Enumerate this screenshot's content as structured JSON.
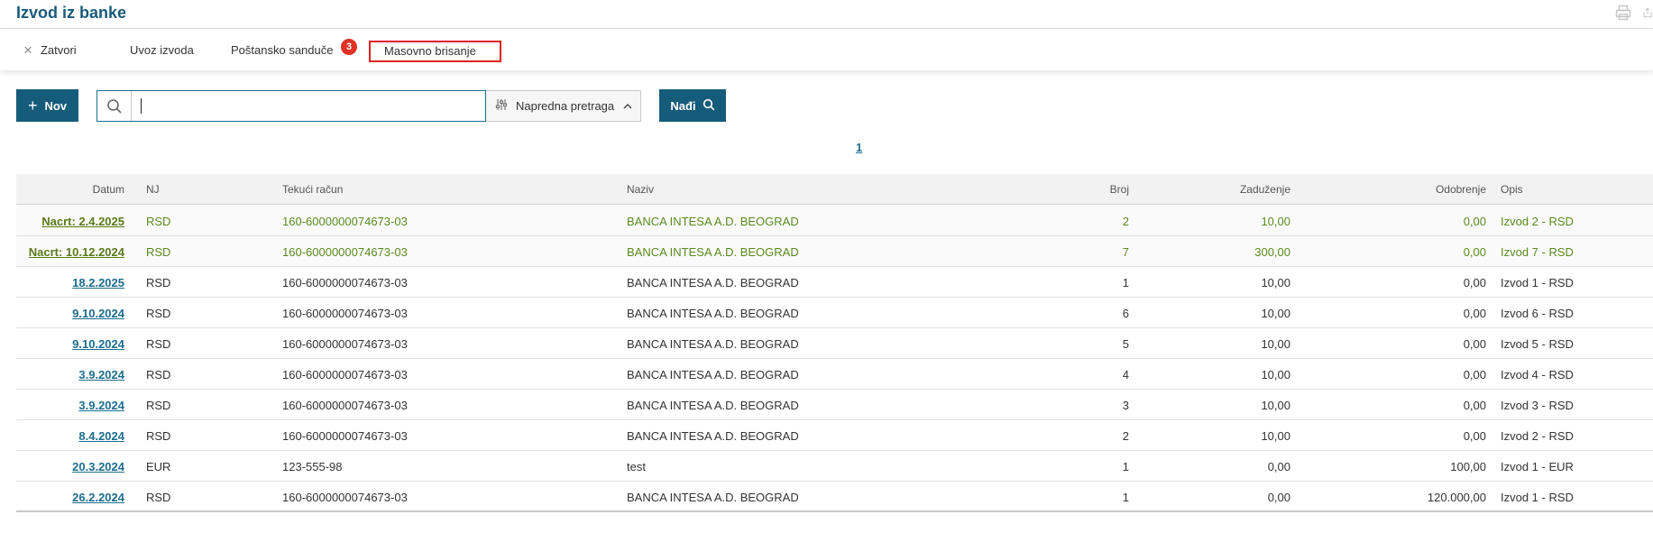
{
  "page": {
    "title": "Izvod iz banke"
  },
  "toolbar": {
    "close_label": "Zatvori",
    "import_label": "Uvoz izvoda",
    "mailbox_label": "Poštansko sanduče",
    "mailbox_badge": "3",
    "mass_delete_label": "Masovno brisanje"
  },
  "actions": {
    "new_label": "Nov",
    "search_value": "",
    "advanced_search_label": "Napredna pretraga",
    "find_label": "Nađi"
  },
  "pagination": {
    "current_page": "1"
  },
  "table": {
    "columns": {
      "date": "Datum",
      "nj": "NJ",
      "account": "Tekući račun",
      "name": "Naziv",
      "number": "Broj",
      "debit": "Zaduženje",
      "credit": "Odobrenje",
      "description": "Opis"
    },
    "rows": [
      {
        "date": "Nacrt: 2.4.2025",
        "nj": "RSD",
        "account": "160-6000000074673-03",
        "name": "BANCA INTESA A.D. BEOGRAD",
        "number": "2",
        "debit": "10,00",
        "credit": "0,00",
        "description": "Izvod 2 - RSD",
        "status": "draft"
      },
      {
        "date": "Nacrt: 10.12.2024",
        "nj": "RSD",
        "account": "160-6000000074673-03",
        "name": "BANCA INTESA A.D. BEOGRAD",
        "number": "7",
        "debit": "300,00",
        "credit": "0,00",
        "description": "Izvod 7 - RSD",
        "status": "draft"
      },
      {
        "date": "18.2.2025",
        "nj": "RSD",
        "account": "160-6000000074673-03",
        "name": "BANCA INTESA A.D. BEOGRAD",
        "number": "1",
        "debit": "10,00",
        "credit": "0,00",
        "description": "Izvod 1 - RSD",
        "status": "final"
      },
      {
        "date": "9.10.2024",
        "nj": "RSD",
        "account": "160-6000000074673-03",
        "name": "BANCA INTESA A.D. BEOGRAD",
        "number": "6",
        "debit": "10,00",
        "credit": "0,00",
        "description": "Izvod 6 - RSD",
        "status": "final"
      },
      {
        "date": "9.10.2024",
        "nj": "RSD",
        "account": "160-6000000074673-03",
        "name": "BANCA INTESA A.D. BEOGRAD",
        "number": "5",
        "debit": "10,00",
        "credit": "0,00",
        "description": "Izvod 5 - RSD",
        "status": "final"
      },
      {
        "date": "3.9.2024",
        "nj": "RSD",
        "account": "160-6000000074673-03",
        "name": "BANCA INTESA A.D. BEOGRAD",
        "number": "4",
        "debit": "10,00",
        "credit": "0,00",
        "description": "Izvod 4 - RSD",
        "status": "final"
      },
      {
        "date": "3.9.2024",
        "nj": "RSD",
        "account": "160-6000000074673-03",
        "name": "BANCA INTESA A.D. BEOGRAD",
        "number": "3",
        "debit": "10,00",
        "credit": "0,00",
        "description": "Izvod 3 - RSD",
        "status": "final"
      },
      {
        "date": "8.4.2024",
        "nj": "RSD",
        "account": "160-6000000074673-03",
        "name": "BANCA INTESA A.D. BEOGRAD",
        "number": "2",
        "debit": "10,00",
        "credit": "0,00",
        "description": "Izvod 2 - RSD",
        "status": "final"
      },
      {
        "date": "20.3.2024",
        "nj": "EUR",
        "account": "123-555-98",
        "name": "test",
        "number": "1",
        "debit": "0,00",
        "credit": "100,00",
        "description": "Izvod 1 - EUR",
        "status": "final"
      },
      {
        "date": "26.2.2024",
        "nj": "RSD",
        "account": "160-6000000074673-03",
        "name": "BANCA INTESA A.D. BEOGRAD",
        "number": "1",
        "debit": "0,00",
        "credit": "120.000,00",
        "description": "Izvod 1 - RSD",
        "status": "final"
      }
    ]
  },
  "colors": {
    "brand": "#155c7a",
    "link": "#1d6d8f",
    "draft_text": "#5a8a1f",
    "badge": "#e03127",
    "highlight_border": "#e02020"
  },
  "icons": {
    "close": "close-icon",
    "print": "printer-icon",
    "export": "export-icon",
    "search": "search-icon",
    "filter": "sliders-icon",
    "chevron": "chevron-up-icon",
    "plus": "plus-icon"
  }
}
